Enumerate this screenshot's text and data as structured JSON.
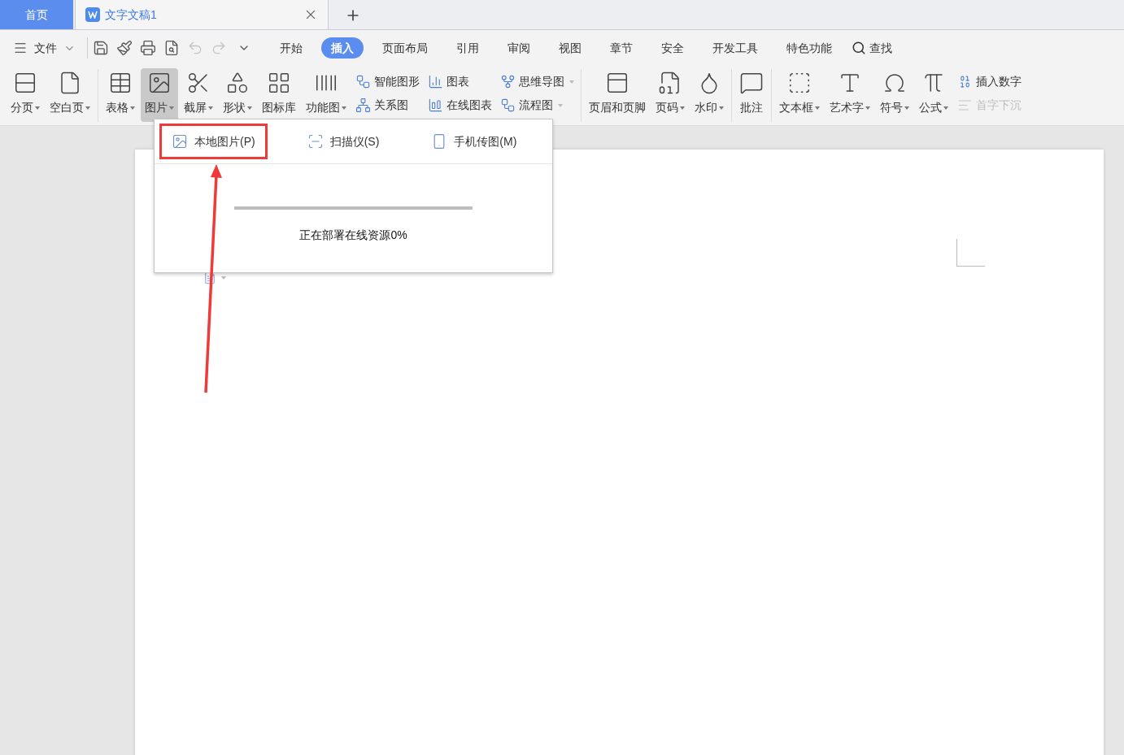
{
  "tabs": [
    {
      "label": "首页",
      "kind": "home",
      "selected": false
    },
    {
      "label": "文字文稿1",
      "kind": "doc",
      "selected": true
    }
  ],
  "menu": {
    "file": "文件",
    "tabs": [
      {
        "label": "开始",
        "selected": false
      },
      {
        "label": "插入",
        "selected": true
      },
      {
        "label": "页面布局",
        "selected": false
      },
      {
        "label": "引用",
        "selected": false
      },
      {
        "label": "审阅",
        "selected": false
      },
      {
        "label": "视图",
        "selected": false
      },
      {
        "label": "章节",
        "selected": false
      },
      {
        "label": "安全",
        "selected": false
      },
      {
        "label": "开发工具",
        "selected": false
      },
      {
        "label": "特色功能",
        "selected": false
      }
    ],
    "search": "查找"
  },
  "quick_access": [
    {
      "disabled": false
    },
    {
      "disabled": false
    },
    {
      "disabled": false
    },
    {
      "disabled": false
    },
    {
      "disabled": true
    },
    {
      "disabled": true
    }
  ],
  "ribbon": [
    [
      {
        "kind": "large",
        "label": "分页",
        "dropdown": true,
        "selected": false
      },
      {
        "kind": "large",
        "label": "空白页",
        "dropdown": true,
        "selected": false
      }
    ],
    [
      {
        "kind": "large",
        "label": "表格",
        "dropdown": true,
        "selected": false
      },
      {
        "kind": "large",
        "label": "图片",
        "dropdown": true,
        "selected": true
      },
      {
        "kind": "large",
        "label": "截屏",
        "dropdown": true,
        "selected": false
      },
      {
        "kind": "large",
        "label": "形状",
        "dropdown": true,
        "selected": false
      },
      {
        "kind": "large",
        "label": "图标库",
        "dropdown": false,
        "selected": false
      },
      {
        "kind": "large",
        "label": "功能图",
        "dropdown": true,
        "selected": false
      },
      {
        "kind": "small",
        "items": [
          {
            "label": "智能图形",
            "dropdown": false,
            "disabled": false
          },
          {
            "label": "关系图",
            "dropdown": false,
            "disabled": false
          }
        ]
      },
      {
        "kind": "small",
        "items": [
          {
            "label": "图表",
            "dropdown": false,
            "disabled": false
          },
          {
            "label": "在线图表",
            "dropdown": false,
            "disabled": false
          }
        ]
      },
      {
        "kind": "small",
        "items": [
          {
            "label": "思维导图",
            "dropdown": true,
            "disabled": false
          },
          {
            "label": "流程图",
            "dropdown": true,
            "disabled": false
          }
        ]
      }
    ],
    [
      {
        "kind": "large",
        "label": "页眉和页脚",
        "dropdown": false,
        "selected": false
      },
      {
        "kind": "large",
        "label": "页码",
        "dropdown": true,
        "selected": false
      },
      {
        "kind": "large",
        "label": "水印",
        "dropdown": true,
        "selected": false
      }
    ],
    [
      {
        "kind": "large",
        "label": "批注",
        "dropdown": false,
        "selected": false
      }
    ],
    [
      {
        "kind": "large",
        "label": "文本框",
        "dropdown": true,
        "selected": false
      },
      {
        "kind": "large",
        "label": "艺术字",
        "dropdown": true,
        "selected": false
      },
      {
        "kind": "large",
        "label": "符号",
        "dropdown": true,
        "selected": false
      },
      {
        "kind": "large",
        "label": "公式",
        "dropdown": true,
        "selected": false
      },
      {
        "kind": "small",
        "items": [
          {
            "label": "插入数字",
            "dropdown": false,
            "disabled": false
          },
          {
            "label": "首字下沉",
            "dropdown": false,
            "disabled": true
          }
        ]
      }
    ]
  ],
  "picture_menu": {
    "options": [
      {
        "label": "本地图片(P)",
        "highlighted": true
      },
      {
        "label": "扫描仪(S)",
        "highlighted": false
      },
      {
        "label": "手机传图(M)",
        "highlighted": false
      }
    ],
    "progress": {
      "level": 0
    },
    "status": "正在部署在线资源0%"
  }
}
